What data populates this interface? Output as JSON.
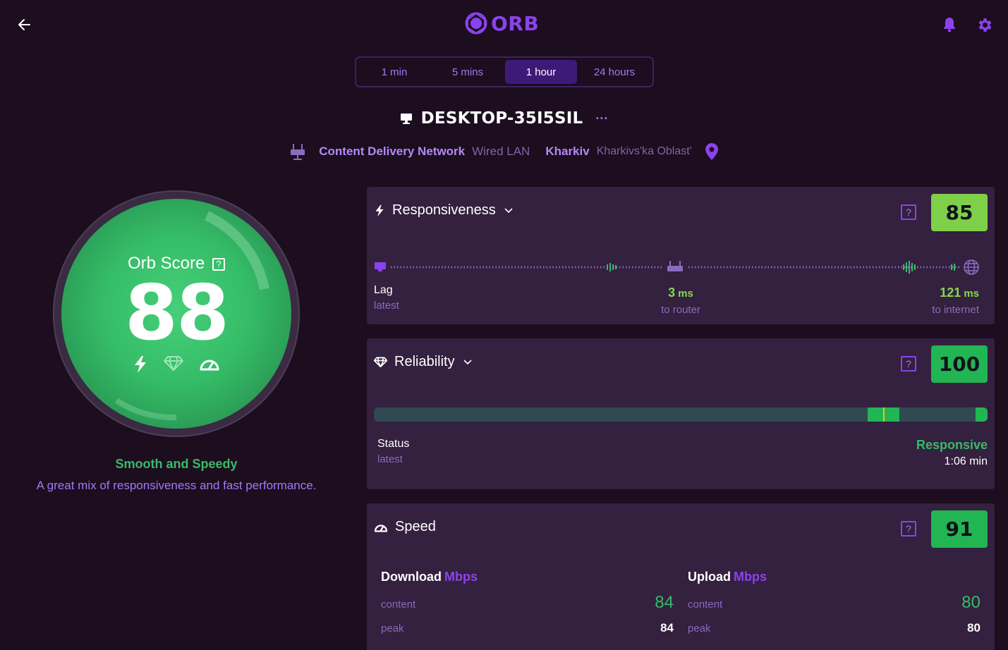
{
  "app": {
    "logo_text": "ORB"
  },
  "range_tabs": [
    {
      "label": "1 min",
      "active": false
    },
    {
      "label": "5 mins",
      "active": false
    },
    {
      "label": "1 hour",
      "active": true
    },
    {
      "label": "24 hours",
      "active": false
    }
  ],
  "device": {
    "name": "DESKTOP-35I5SIL",
    "more_label": "···"
  },
  "network": {
    "name": "Content Delivery Network",
    "type": "Wired LAN",
    "city": "Kharkiv",
    "region": "Kharkivs'ka Oblast'"
  },
  "orb": {
    "title": "Orb Score",
    "help": "?",
    "score": "88",
    "summary_title": "Smooth and Speedy",
    "summary_text": "A great mix of responsiveness and fast performance."
  },
  "responsiveness": {
    "title": "Responsiveness",
    "help": "?",
    "score": "85",
    "score_color": "#7ed04a",
    "lag_label": "Lag",
    "lag_sub": "latest",
    "router_value": "3",
    "router_unit": "ms",
    "router_label": "to router",
    "internet_value": "121",
    "internet_unit": "ms",
    "internet_label": "to internet"
  },
  "reliability": {
    "title": "Reliability",
    "help": "?",
    "score": "100",
    "score_color": "#22b554",
    "status_label": "Status",
    "status_sub": "latest",
    "status_value": "Responsive",
    "status_time": "1:06 min"
  },
  "speed": {
    "title": "Speed",
    "help": "?",
    "score": "91",
    "score_color": "#22b554",
    "download": {
      "title": "Download",
      "unit": "Mbps",
      "content_label": "content",
      "content_value": "84",
      "peak_label": "peak",
      "peak_value": "84"
    },
    "upload": {
      "title": "Upload",
      "unit": "Mbps",
      "content_label": "content",
      "content_value": "80",
      "peak_label": "peak",
      "peak_value": "80"
    }
  },
  "colors": {
    "background": "#1c0d1f",
    "accent": "#8a43ec",
    "card": "#34203f",
    "good": "#35bc67"
  }
}
